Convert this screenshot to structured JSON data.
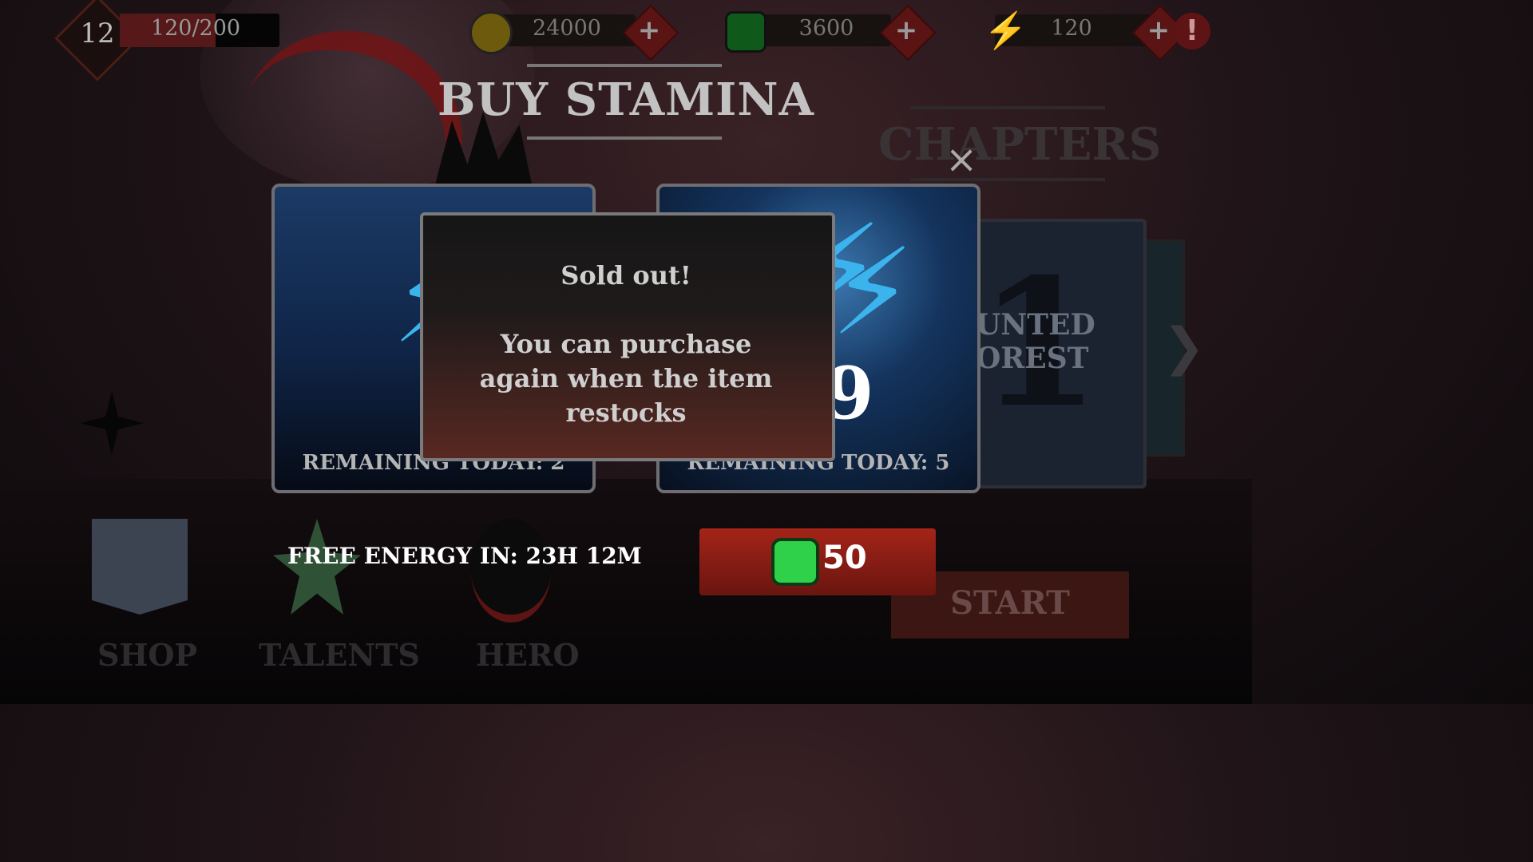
{
  "hud": {
    "level": "12",
    "xp": "120/200",
    "xp_progress": 0.6,
    "coins": "24000",
    "gems": "3600",
    "energy": "120",
    "plus": "+",
    "alert": "!"
  },
  "background": {
    "chapters_title": "CHAPTERS",
    "chapter_number": "1",
    "chapter_name": "UNTED\nOREST"
  },
  "dialog": {
    "title": "BUY STAMINA",
    "close": "×",
    "offers": [
      {
        "remaining": "REMAINING TODAY: 2"
      },
      {
        "amount": "9",
        "remaining": "REMAINING TODAY: 5"
      }
    ],
    "free_energy": "FREE ENERGY IN: 23H 12M",
    "price": "50"
  },
  "modal": {
    "title": "Sold out!",
    "message": "You can purchase again when the item restocks"
  },
  "nav": {
    "shop": "SHOP",
    "talents": "TALENTS",
    "hero": "HERO",
    "start": "START"
  }
}
